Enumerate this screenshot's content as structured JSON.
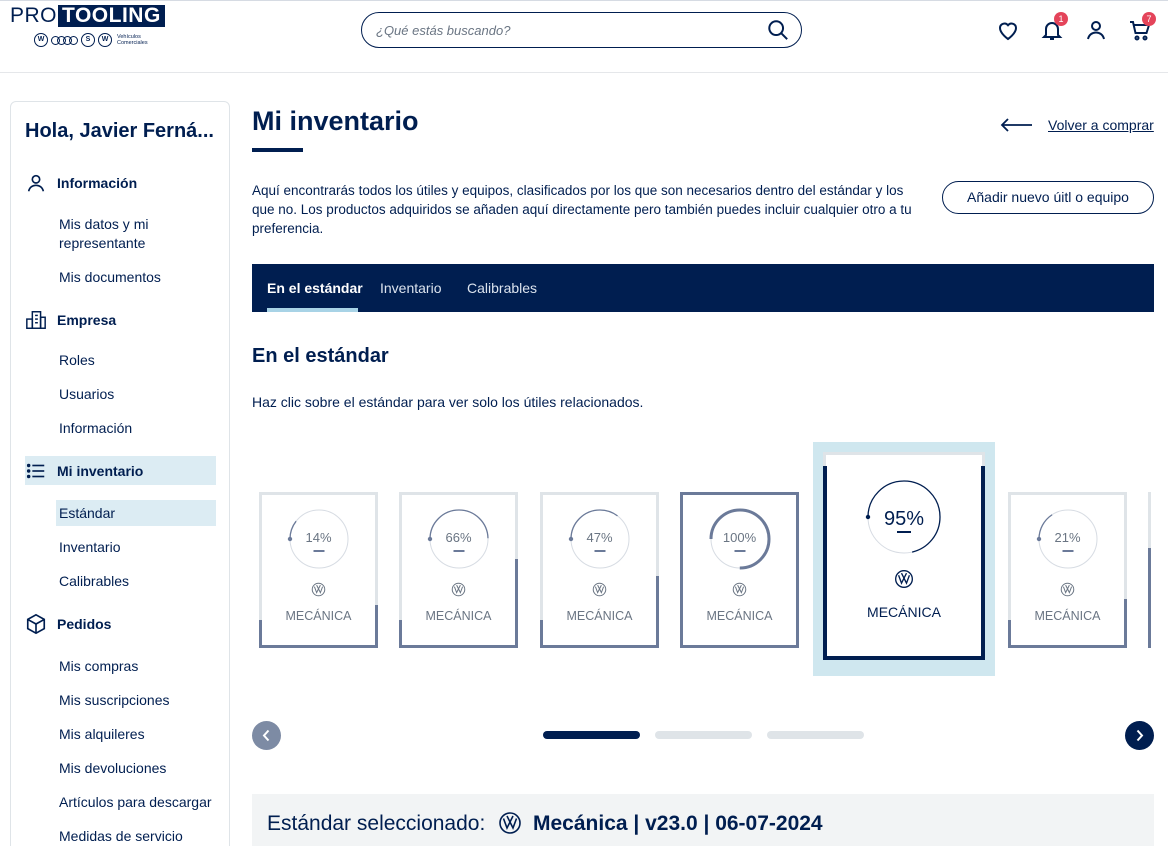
{
  "header": {
    "logo_pro": "PRO",
    "logo_tooling": "TOOLING",
    "logo_sub": "Vehículos Comerciales",
    "search_placeholder": "¿Qué estás buscando?",
    "notifications_count": "1",
    "cart_count": "7"
  },
  "sidebar": {
    "greeting": "Hola, Javier Ferná...",
    "sections": [
      {
        "label": "Información",
        "items": [
          "Mis datos y mi representante",
          "Mis documentos"
        ]
      },
      {
        "label": "Empresa",
        "items": [
          "Roles",
          "Usuarios",
          "Información"
        ]
      },
      {
        "label": "Mi inventario",
        "items": [
          "Estándar",
          "Inventario",
          "Calibrables"
        ]
      },
      {
        "label": "Pedidos",
        "items": [
          "Mis compras",
          "Mis suscripciones",
          "Mis alquileres",
          "Mis devoluciones",
          "Artículos para descargar",
          "Medidas de servicio"
        ]
      }
    ]
  },
  "main": {
    "title": "Mi inventario",
    "back_link": "Volver a comprar",
    "description": "Aquí encontrarás todos los útiles y equipos, clasificados por los que son necesarios dentro del estándar y los que no. Los productos adquiridos se añaden aquí directamente pero también puedes incluir cualquier otro a tu preferencia.",
    "add_button": "Añadir nuevo úitl o equipo",
    "tabs": [
      "En el estándar",
      "Inventario",
      "Calibrables"
    ],
    "section_title": "En el estándar",
    "hint": "Haz clic sobre el estándar para ver solo los útiles relacionados.",
    "cards": [
      {
        "percent": "14%",
        "value": 0.14,
        "label": "MECÁNICA"
      },
      {
        "percent": "66%",
        "value": 0.66,
        "label": "MECÁNICA"
      },
      {
        "percent": "47%",
        "value": 0.47,
        "label": "MECÁNICA"
      },
      {
        "percent": "100%",
        "value": 1.0,
        "label": "MECÁNICA"
      },
      {
        "percent": "95%",
        "value": 0.95,
        "label": "MECÁNICA"
      },
      {
        "percent": "21%",
        "value": 0.21,
        "label": "MECÁNICA"
      }
    ],
    "selected_label": "Estándar seleccionado:",
    "selected_value": "Mecánica | v23.0 | 06-07-2024"
  },
  "colors": {
    "navy": "#001e50",
    "accent_light": "#dcecf3",
    "slate": "#6b7a99",
    "badge": "#e4445a"
  }
}
